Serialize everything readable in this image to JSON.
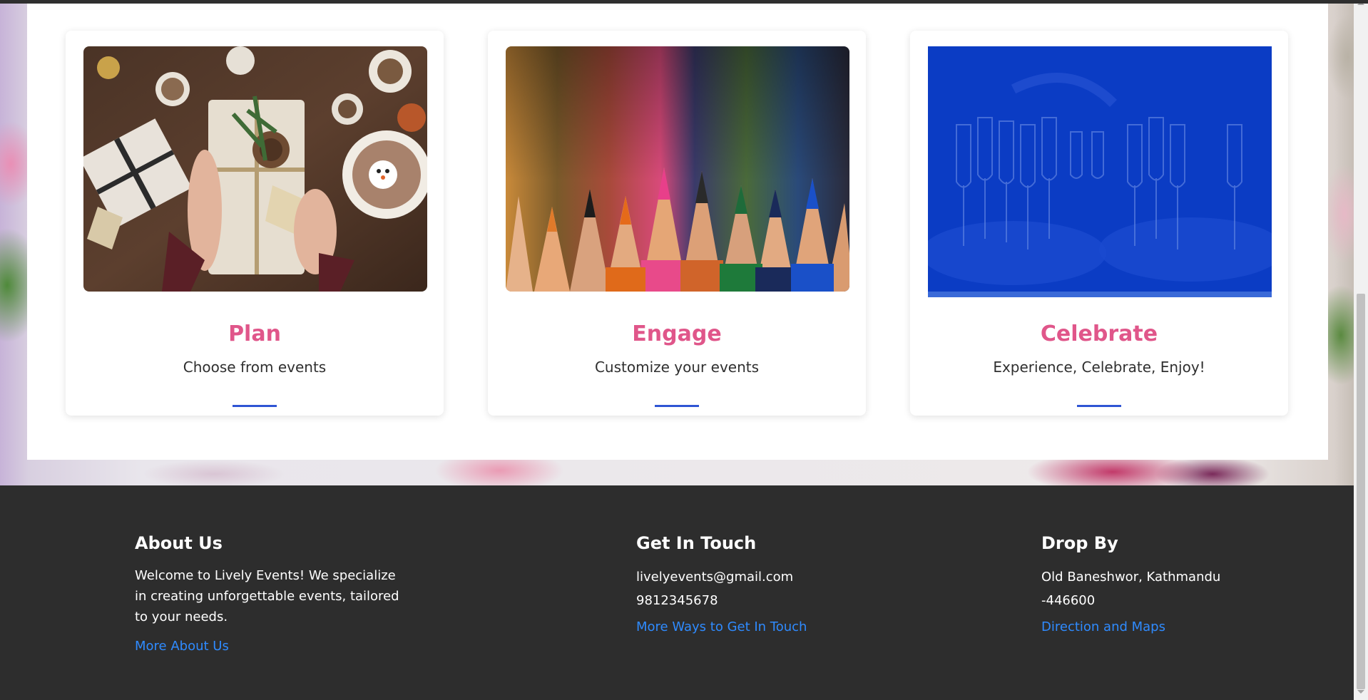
{
  "cards": [
    {
      "title": "Plan",
      "subtitle": "Choose from events",
      "image": "gift-box-photo"
    },
    {
      "title": "Engage",
      "subtitle": "Customize your events",
      "image": "colored-pencils-photo"
    },
    {
      "title": "Celebrate",
      "subtitle": "Experience, Celebrate, Enjoy!",
      "image": "champagne-glasses-photo"
    }
  ],
  "footer": {
    "about": {
      "heading": "About Us",
      "text": "Welcome to Lively Events! We specialize in creating unforgettable events, tailored to your needs.",
      "link": "More About Us"
    },
    "touch": {
      "heading": "Get In Touch",
      "email": "livelyevents@gmail.com",
      "phone": "9812345678",
      "link": "More Ways to Get In Touch"
    },
    "drop": {
      "heading": "Drop By",
      "address_line1": "Old Baneshwor, Kathmandu",
      "address_line2": "-446600",
      "link": "Direction and Maps"
    }
  },
  "colors": {
    "card_title": "#e0568a",
    "accent_underline": "#2f55d4",
    "footer_bg": "#2d2d2d",
    "footer_link": "#2f8bff",
    "celebrate_overlay": "#0a3cc8"
  }
}
